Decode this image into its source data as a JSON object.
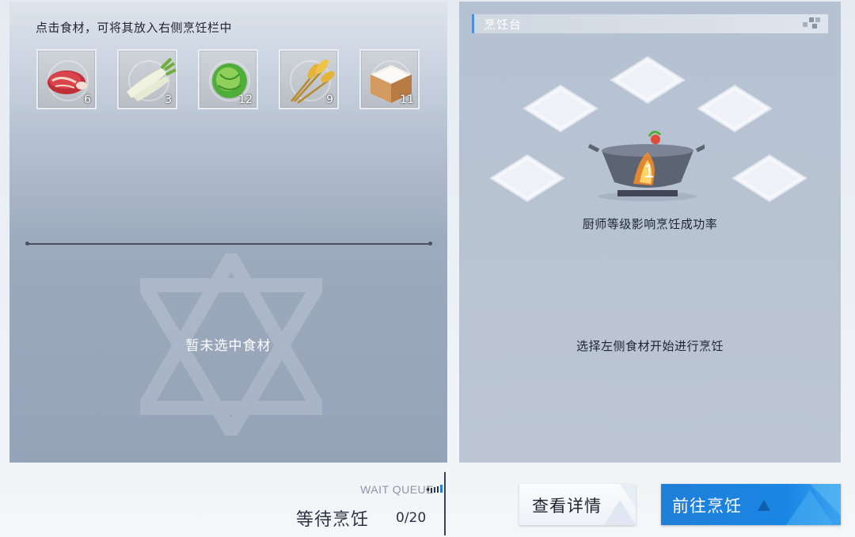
{
  "left_panel": {
    "hint": "点击食材，可将其放入右侧烹饪栏中",
    "ingredients": [
      {
        "icon": "meat-icon",
        "count": "6"
      },
      {
        "icon": "radish-icon",
        "count": "3"
      },
      {
        "icon": "cabbage-icon",
        "count": "12"
      },
      {
        "icon": "wheat-icon",
        "count": "9"
      },
      {
        "icon": "rice-box-icon",
        "count": "11"
      }
    ],
    "empty_text": "暂未选中食材"
  },
  "right_panel": {
    "title": "烹饪台",
    "pot_icon": "cooking-pot-icon",
    "chef_hint": "厨师等级影响烹饪成功率",
    "select_hint": "选择左侧食材开始进行烹饪"
  },
  "queue": {
    "label": "WAIT QUEUE",
    "title": "等待烹饪",
    "count": "0/20"
  },
  "buttons": {
    "details": "查看详情",
    "go_cook": "前往烹饪"
  },
  "colors": {
    "accent_blue": "#1a86e4",
    "panel_left": "#9eabbe",
    "panel_right": "#b8c3d2"
  }
}
